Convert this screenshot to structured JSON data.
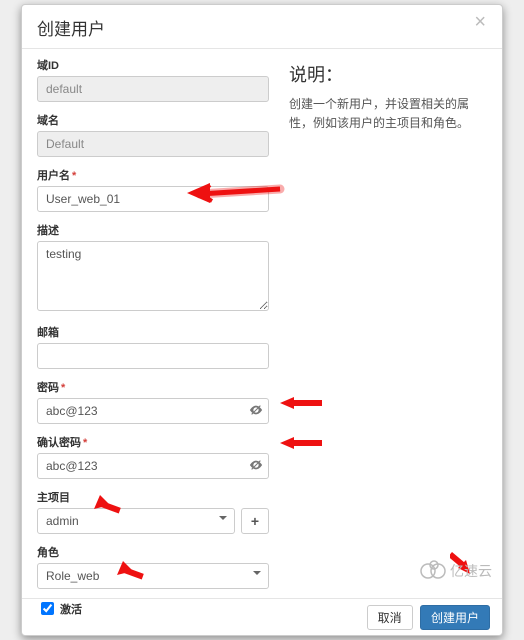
{
  "modal": {
    "title": "创建用户",
    "close": "×"
  },
  "form": {
    "domain_id": {
      "label": "域ID",
      "value": "default"
    },
    "domain_name": {
      "label": "域名",
      "value": "Default"
    },
    "username": {
      "label": "用户名",
      "value": "User_web_01"
    },
    "description": {
      "label": "描述",
      "value": "testing"
    },
    "email": {
      "label": "邮箱",
      "value": ""
    },
    "password": {
      "label": "密码",
      "value": "abc@123"
    },
    "confirm_password": {
      "label": "确认密码",
      "value": "abc@123"
    },
    "project": {
      "label": "主项目",
      "value": "admin"
    },
    "role": {
      "label": "角色",
      "value": "Role_web"
    },
    "active": {
      "label": "激活",
      "checked": true
    }
  },
  "help": {
    "title": "说明：",
    "body": "创建一个新用户，并设置相关的属性，例如该用户的主项目和角色。"
  },
  "footer": {
    "cancel": "取消",
    "submit": "创建用户"
  },
  "watermark": "亿速云"
}
